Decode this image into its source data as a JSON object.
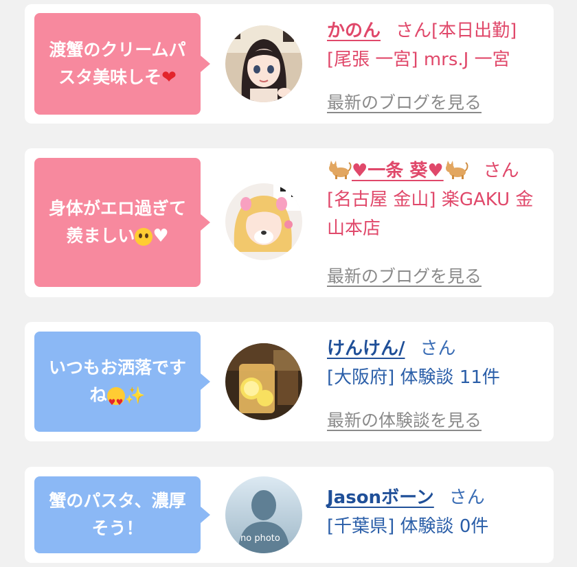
{
  "feed": {
    "items": [
      {
        "comment": "渡蟹のクリームパスタ美味しそ",
        "comment_emoji": "heart",
        "name": "かのん",
        "suffix": "さん[本日出勤]",
        "details": "[尾張 一宮] mrs.J 一宮",
        "link": "最新のブログを見る",
        "theme": "pink"
      },
      {
        "comment": "身体がエロ過ぎて羨ましい",
        "comment_emoji": "pleading-face-and-white-heart",
        "name_prefix_icon": "cat-icon",
        "name": "♥一条 葵♥",
        "name_suffix_icon": "cat-icon",
        "suffix": "さん",
        "details": "[名古屋 金山] 楽GAKU 金山本店",
        "link": "最新のブログを見る",
        "theme": "pink"
      },
      {
        "comment": "いつもお洒落ですね",
        "comment_emoji": "heart-eyes-face-and-sparkles",
        "name": "けんけん/",
        "suffix": "さん",
        "details": "[大阪府] 体験談 11件",
        "link": "最新の体験談を見る",
        "theme": "blue"
      },
      {
        "comment": "蟹のパスタ、濃厚そう！",
        "name": "Jasonボーン",
        "suffix": "さん",
        "details": "[千葉県] 体験談 0件",
        "avatar_text": "no photo",
        "theme": "blue"
      }
    ]
  }
}
